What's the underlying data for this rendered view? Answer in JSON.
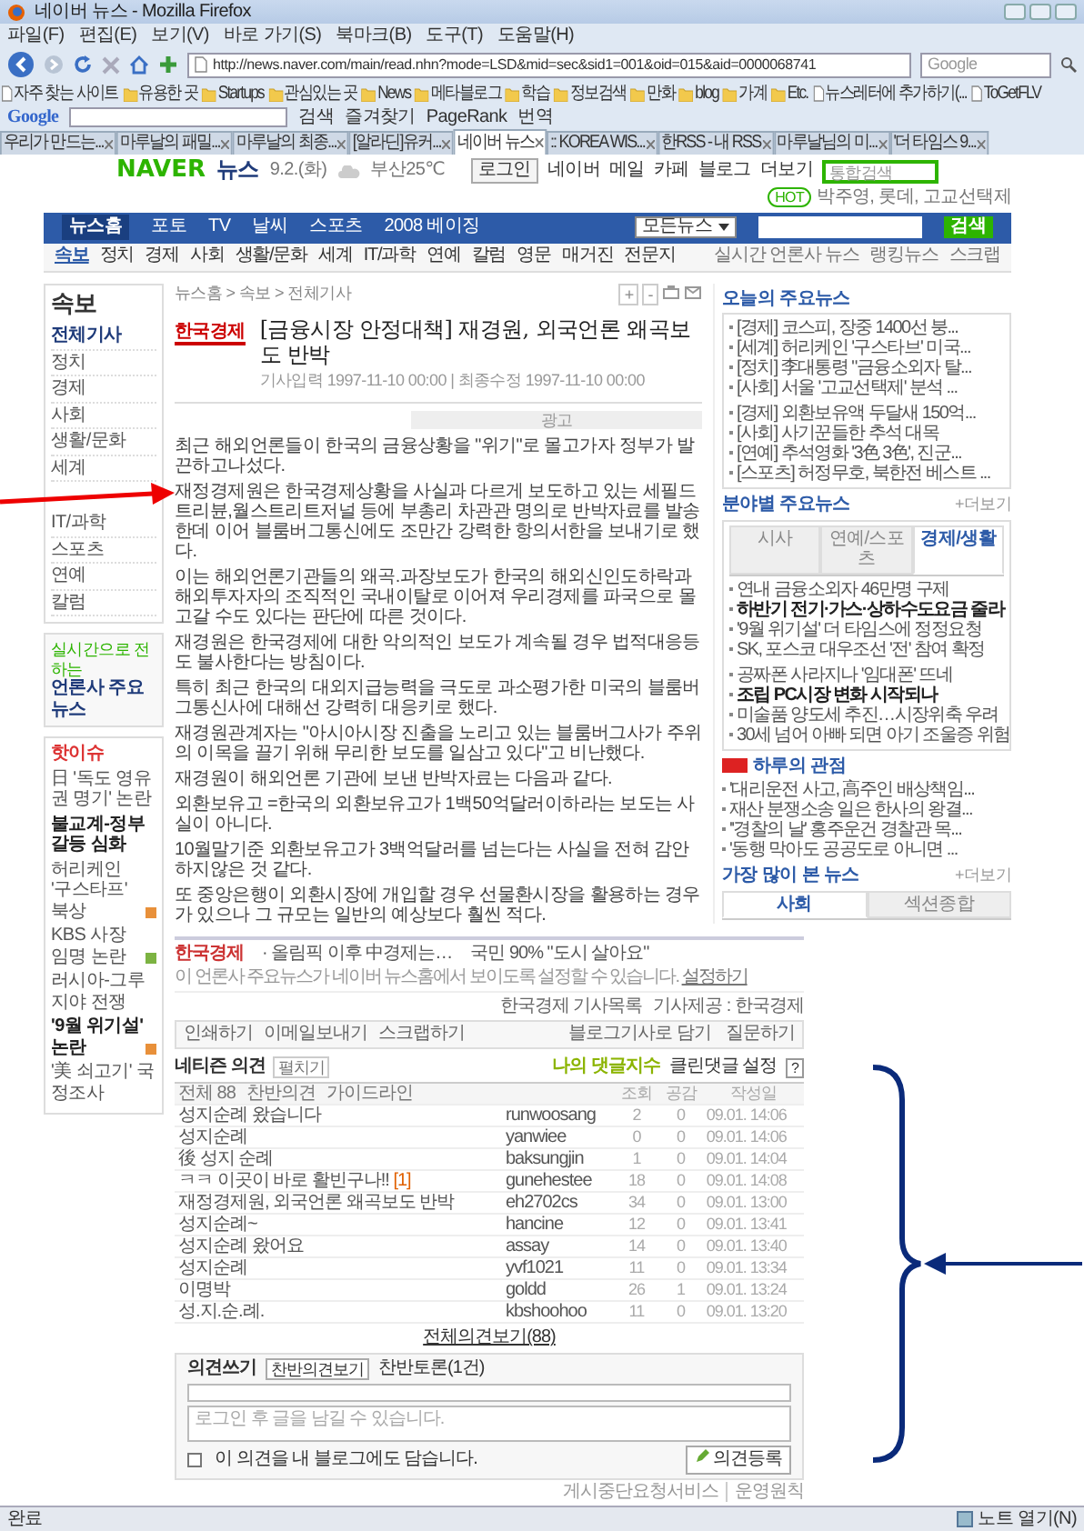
{
  "window": {
    "title": "네이버 뉴스 - Mozilla Firefox"
  },
  "menu": [
    "파일(F)",
    "편집(E)",
    "보기(V)",
    "바로 가기(S)",
    "북마크(B)",
    "도구(T)",
    "도움말(H)"
  ],
  "address": {
    "url": "http://news.naver.com/main/read.nhn?mode=LSD&mid=sec&sid1=001&oid=015&aid=0000068741"
  },
  "web_search": {
    "placeholder": "Google"
  },
  "bookmarks": [
    {
      "label": "자주 찾는 사이트",
      "kind": "page"
    },
    {
      "label": "유용한 곳",
      "kind": "folder"
    },
    {
      "label": "Startups",
      "kind": "folder"
    },
    {
      "label": "관심있는 곳",
      "kind": "folder"
    },
    {
      "label": "News",
      "kind": "folder"
    },
    {
      "label": "메타블로그",
      "kind": "folder"
    },
    {
      "label": "학습",
      "kind": "folder"
    },
    {
      "label": "정보검색",
      "kind": "folder"
    },
    {
      "label": "만화",
      "kind": "folder"
    },
    {
      "label": "blog",
      "kind": "folder"
    },
    {
      "label": "가계",
      "kind": "folder"
    },
    {
      "label": "Etc.",
      "kind": "folder"
    },
    {
      "label": "뉴스레터에 추가하기(...",
      "kind": "page"
    },
    {
      "label": "ToGetFLV",
      "kind": "page"
    }
  ],
  "google_toolbar": {
    "logo": "Google",
    "items": [
      "검색",
      "즐겨찾기",
      "PageRank",
      "번역"
    ]
  },
  "tabs": [
    {
      "label": "우리가 만드는...",
      "selected": false
    },
    {
      "label": "마루날의 패밀...",
      "selected": false
    },
    {
      "label": "마루날의 최종...",
      "selected": false
    },
    {
      "label": "[알라딘]유커...",
      "selected": false
    },
    {
      "label": "네이버 뉴스",
      "selected": true
    },
    {
      "label": ":: KOREA WIS...",
      "selected": false
    },
    {
      "label": "한RSS - 내 RSS",
      "selected": false
    },
    {
      "label": "마루날님의 미...",
      "selected": false
    },
    {
      "label": "'더 타임스 9...",
      "selected": false
    }
  ],
  "header": {
    "logo": "NAVER",
    "section": "뉴스",
    "date": "9.2.(화)",
    "weather": "부산25℃",
    "links": [
      "로그인",
      "네이버",
      "메일",
      "카페",
      "블로그",
      "더보기"
    ],
    "search_placeholder": "통합검색",
    "hot_label": "HOT",
    "hot_text": "박주영, 롯데, 고교선택제"
  },
  "main_nav": [
    {
      "label": "뉴스홈",
      "selected": true
    },
    {
      "label": "포토",
      "selected": false
    },
    {
      "label": "TV",
      "selected": false
    },
    {
      "label": "날씨",
      "selected": false
    },
    {
      "label": "스포츠",
      "selected": false
    },
    {
      "label": "2008 베이징",
      "selected": false
    }
  ],
  "news_search": {
    "scope": "모든뉴스",
    "button": "검색"
  },
  "section_nav": [
    {
      "label": "속보",
      "selected": true
    },
    {
      "label": "정치",
      "selected": false
    },
    {
      "label": "경제",
      "selected": false
    },
    {
      "label": "사회",
      "selected": false
    },
    {
      "label": "생활/문화",
      "selected": false
    },
    {
      "label": "세계",
      "selected": false
    },
    {
      "label": "IT/과학",
      "selected": false
    },
    {
      "label": "연예",
      "selected": false
    },
    {
      "label": "칼럼",
      "selected": false
    },
    {
      "label": "영문",
      "selected": false
    },
    {
      "label": "매거진",
      "selected": false
    },
    {
      "label": "전문지",
      "selected": false
    }
  ],
  "section_links": [
    "실시간 언론사 뉴스",
    "랭킹뉴스",
    "스크랩"
  ],
  "sidebar": {
    "title": "속보",
    "items": [
      {
        "label": "전체기사",
        "selected": true
      },
      {
        "label": "정치",
        "selected": false
      },
      {
        "label": "경제",
        "selected": false
      },
      {
        "label": "사회",
        "selected": false
      },
      {
        "label": "생활/문화",
        "selected": false
      },
      {
        "label": "세계",
        "selected": false
      },
      {
        "label": "IT/과학",
        "selected": false
      },
      {
        "label": "스포츠",
        "selected": false
      },
      {
        "label": "연예",
        "selected": false
      },
      {
        "label": "칼럼",
        "selected": false
      }
    ],
    "press_caption": "실시간으로 전하는",
    "press_title": "언론사 주요뉴스",
    "hot_title": "핫이슈",
    "hot_issues": [
      {
        "label": "日 '독도 영유권 명기' 논란",
        "bold": false
      },
      {
        "label": "불교계-정부 갈등 심화",
        "bold": true
      },
      {
        "label": "허리케인 '구스타프' 북상",
        "bold": false,
        "color": "#e8903a"
      },
      {
        "label": "KBS 사장 임명 논란",
        "bold": false,
        "color": "#7cb342"
      },
      {
        "label": "러시아-그루지야 전쟁",
        "bold": false
      },
      {
        "label": "'9월 위기설' 논란",
        "bold": true,
        "color": "#e8903a"
      },
      {
        "label": "'美 쇠고기' 국정조사",
        "bold": false
      }
    ]
  },
  "article": {
    "breadcrumb": "뉴스홈 > 속보 > 전체기사",
    "zoom_in": "+",
    "zoom_out": "-",
    "source": "한국경제",
    "title": "[금융시장 안정대책] 재경원, 외국언론 왜곡보도 반박",
    "meta": "기사입력 1997-11-10 00:00 | 최종수정 1997-11-10 00:00",
    "ad_label": "광고",
    "paragraphs": [
      "최근 해외언론들이 한국의 금융상황을 \"위기\"로 몰고가자 정부가 발끈하고나섰다.",
      "재정경제원은 한국경제상황을 사실과 다르게 보도하고 있는 세필드트리뷴,월스트리트저널 등에 부총리 차관관 명의로 반박자료를 발송한데 이어 블룸버그통신에도 조만간 강력한 항의서한을 보내기로 했다.",
      "이는 해외언론기관들의 왜곡.과장보도가 한국의 해외신인도하락과 해외투자자의 조직적인 국내이탈로 이어져 우리경제를 파국으로 몰고갈 수도 있다는 판단에 따른 것이다.",
      "재경원은 한국경제에 대한 악의적인 보도가 계속될 경우 법적대응등도 불사한다는 방침이다.",
      "특히 최근 한국의 대외지급능력을 극도로 과소평가한 미국의 블룸버그통신사에 대해선 강력히 대응키로 했다.",
      "재경원관계자는 \"아시아시장 진출을 노리고 있는 블룸버그사가 주위의 이목을 끌기 위해 무리한 보도를 일삼고 있다\"고 비난했다.",
      "재경원이 해외언론 기관에 보낸 반박자료는 다음과 같다.",
      "외환보유고 =한국의 외환보유고가 1백50억달러이하라는 보도는 사실이 아니다.",
      "10월말기준 외환보유고가 3백억달러를 넘는다는 사실을 전혀 감안하지않은 것 같다.",
      "또 중앙은행이 외환시장에 개입할 경우 선물환시장을 활용하는 경우가 있으나 그 규모는 일반의 예상보다 훨씬 적다."
    ]
  },
  "right_sidebar": {
    "top_title": "오늘의 주요뉴스",
    "top_news": [
      "[경제] 코스피, 장중 1400선 붕...",
      "[세계] 허리케인 '구스타브' 미국...",
      "[정치] 李대통령 \"금융소외자 탈...",
      "[사회] 서울 '고교선택제' 분석 ...",
      "[경제] 외환보유액 두달새 150억...",
      "[사회] 사기꾼들한 추석 대목",
      "[연예] 추석영화 '3色 3色', 진군...",
      "[스포츠] 허정무호, 북한전 베스트 ..."
    ],
    "field_title": "분야별 주요뉴스",
    "field_more": "+더보기",
    "field_tabs": [
      {
        "label": "시사",
        "selected": false
      },
      {
        "label": "연예/스포츠",
        "selected": false
      },
      {
        "label": "경제/생활",
        "selected": true
      }
    ],
    "field_news": [
      {
        "label": "연내 금융소외자 46만명 구제",
        "bold": false
      },
      {
        "label": "하반기 전기·가스·상하수도요금 줄라",
        "bold": true
      },
      {
        "label": "'9월 위기설' 더 타임스에 정정요청",
        "bold": false
      },
      {
        "label": "SK, 포스코 대우조선 '전' 참여 확정",
        "bold": false
      },
      {
        "label": "공짜폰 사라지나 '임대폰' 뜨네",
        "bold": false
      },
      {
        "label": "조립 PC시장 변화 시작되나",
        "bold": true
      },
      {
        "label": "미술품 양도세 추진…시장위축 우려",
        "bold": false
      },
      {
        "label": "30세 넘어 아빠 되면 아기 조울증 위험",
        "bold": false
      }
    ],
    "view_title": "하루의 관점",
    "view_news": [
      "'대리운전 사고, 高주인 배상책임...",
      "재산 분쟁소송 일은 한사의 왕결...",
      "''경찰의 날' 홍주운건 경찰관 목...",
      "'동행 막아도 공공도로 아니면 ..."
    ],
    "most_title": "가장 많이 본 뉴스",
    "most_more": "+더보기",
    "most_tabs": [
      {
        "label": "사회",
        "selected": true
      },
      {
        "label": "섹션종합",
        "selected": false
      }
    ]
  },
  "bottom": {
    "press_logo": "한국경제",
    "teasers": [
      "· 올림픽 이후 中경제는…",
      "국민 90% \"도시 살아요\""
    ],
    "notice": "이 언론사 주요뉴스가 네이버 뉴스홈에서 보이도록 설정할 수 있습니다.",
    "notice_link": "설정하기",
    "source_links": [
      "한국경제 기사목록",
      "기사제공 : 한국경제"
    ],
    "tools": [
      "인쇄하기",
      "이메일보내기",
      "스크랩하기"
    ],
    "tools_right": [
      "블로그기사로 담기",
      "질문하기"
    ]
  },
  "comments": {
    "title": "네티즌 의견",
    "expand": "펼치기",
    "my_index": "나의 댓글지수",
    "clean_setting": "클린댓글 설정",
    "help": "?",
    "filters": [
      "전체 88",
      "찬반의견",
      "가이드라인"
    ],
    "columns": [
      "조회",
      "공감",
      "작성일"
    ],
    "rows": [
      {
        "title": "성지순례 왔습니다",
        "user": "runwoosang",
        "views": "2",
        "likes": "0",
        "date": "09.01. 14:06"
      },
      {
        "title": "성지순례",
        "user": "yanwiee",
        "views": "0",
        "likes": "0",
        "date": "09.01. 14:06"
      },
      {
        "title": "後 성지 순례",
        "user": "baksungjin",
        "views": "1",
        "likes": "0",
        "date": "09.01. 14:04"
      },
      {
        "title": "ㅋㅋ 이곳이 바로 활빈구나!!",
        "replies": "[1]",
        "user": "gunehestee",
        "views": "18",
        "likes": "0",
        "date": "09.01. 14:08"
      },
      {
        "title": "재정경제원, 외국언론 왜곡보도 반박",
        "user": "eh2702cs",
        "views": "34",
        "likes": "0",
        "date": "09.01. 13:00"
      },
      {
        "title": "성지순례~",
        "user": "hancine",
        "views": "12",
        "likes": "0",
        "date": "09.01. 13:41"
      },
      {
        "title": "성지순례 왔어요",
        "user": "assay",
        "views": "14",
        "likes": "0",
        "date": "09.01. 13:40"
      },
      {
        "title": "성지순례",
        "user": "yvf1021",
        "views": "11",
        "likes": "0",
        "date": "09.01. 13:34"
      },
      {
        "title": "이명박",
        "user": "goldd",
        "views": "26",
        "likes": "1",
        "date": "09.01. 13:24"
      },
      {
        "title": "성.지.순.례.",
        "user": "kbshoohoo",
        "views": "11",
        "likes": "0",
        "date": "09.01. 13:20"
      }
    ],
    "more": "전체의견보기(88)"
  },
  "comment_form": {
    "tab": "의견쓰기",
    "view_button": "찬반의견보기",
    "debate": "찬반토론(1건)",
    "placeholder": "로그인 후 글을 남길 수 있습니다.",
    "share": {
      "label": "이 의견을 내 블로그에도 담습니다.",
      "checked": false
    },
    "submit": "의견등록"
  },
  "footer_links": [
    "게시중단요청서비스",
    "운영원칙"
  ],
  "status_bar": {
    "text": "완료",
    "note": "노트 열기(N)"
  }
}
